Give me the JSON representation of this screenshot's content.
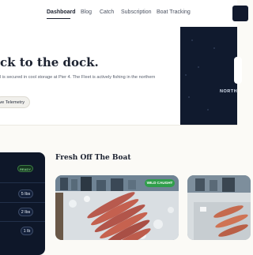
{
  "nav": {
    "items": [
      {
        "label": "Dashboard",
        "active": true
      },
      {
        "label": "Blog",
        "active": false
      },
      {
        "label": "Catch",
        "active": false
      },
      {
        "label": "Subscription",
        "active": false
      },
      {
        "label": "Boat Tracking",
        "active": false
      }
    ]
  },
  "hero": {
    "title": "ck to the dock.",
    "subtitle": "l is secured in cool storage at Pier 4. The Fleet is actively fishing in the northern",
    "button_label": "ive Telemetry"
  },
  "side_panel": {
    "label": "NORTH"
  },
  "status_card": {
    "badge": "READY",
    "weights": [
      "5 lbs",
      "2 lbs",
      "1 lb"
    ]
  },
  "catch_section": {
    "title": "Fresh Off The Boat",
    "cards": [
      {
        "badge": "WILD CAUGHT"
      },
      {
        "badge": ""
      }
    ]
  },
  "colors": {
    "navy": "#101a2e",
    "ready_green": "#7fd08a",
    "badge_green": "#2f9e4a"
  }
}
